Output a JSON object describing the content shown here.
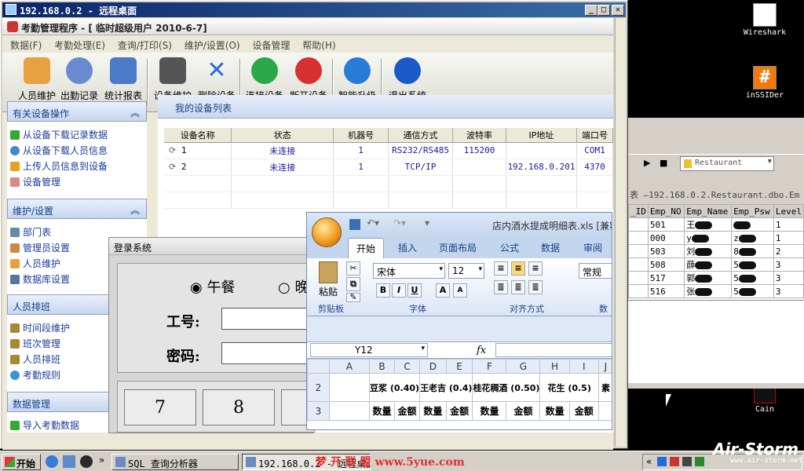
{
  "desktop": {
    "icons": [
      {
        "label": "Wireshark",
        "icon": "wireshark-icon"
      },
      {
        "label": "inSSIDer",
        "icon": "inssider-icon"
      },
      {
        "label": "Cain",
        "icon": "cain-icon"
      }
    ]
  },
  "sql_window": {
    "database_combo": "Restaurant",
    "tab_title": "表 —192.168.0.2.Restaurant.dbo.Em",
    "columns": [
      "_ID",
      "Emp_NO",
      "Emp_Name",
      "Emp_Psw",
      "Level"
    ],
    "rows": [
      {
        "emp_no": "501",
        "name": "王",
        "level": "1"
      },
      {
        "emp_no": "000",
        "name": "y",
        "psw": "z",
        "level": "1"
      },
      {
        "emp_no": "503",
        "name": "刘",
        "psw": "8",
        "level": "2"
      },
      {
        "emp_no": "508",
        "name": "薛",
        "psw": "5",
        "level": "3"
      },
      {
        "emp_no": "517",
        "name": "郭",
        "psw": "5",
        "level": "3"
      },
      {
        "emp_no": "516",
        "name": "张",
        "psw": "5",
        "level": "3"
      }
    ]
  },
  "rdp": {
    "title": "192.168.0.2 - 远程桌面",
    "min": "_",
    "max": "□",
    "close": "✕"
  },
  "app": {
    "title": "考勤管理程序 - [ 临时超级用户 2010-6-7]",
    "menu": [
      "数据(F)",
      "考勤处理(E)",
      "查询/打印(S)",
      "维护/设置(O)",
      "设备管理",
      "帮助(H)"
    ],
    "toolbar": [
      {
        "label": "人员维护",
        "icon": "people-icon",
        "color": "#e8a040"
      },
      {
        "label": "出勤记录",
        "icon": "clock-icon",
        "color": "#6a8ad0"
      },
      {
        "label": "统计报表",
        "icon": "report-icon",
        "color": "#4a7ac8"
      },
      {
        "label": "设备维护",
        "icon": "device-icon",
        "color": "#555555"
      },
      {
        "label": "删除设备",
        "icon": "delete-icon",
        "color": "#2a6ad8"
      },
      {
        "label": "连接设备",
        "icon": "connect-icon",
        "color": "#2aa84a"
      },
      {
        "label": "断开设备",
        "icon": "disconnect-icon",
        "color": "#d83030"
      },
      {
        "label": "智能升级",
        "icon": "globe-icon",
        "color": "#2a7ad8"
      },
      {
        "label": "退出系统",
        "icon": "power-icon",
        "color": "#1a5ac8"
      }
    ],
    "sidebar": {
      "device_ops": {
        "header": "有关设备操作",
        "items": [
          "从设备下载记录数据",
          "从设备下载人员信息",
          "上传人员信息到设备",
          "设备管理"
        ]
      },
      "maintenance": {
        "header": "维护/设置",
        "items": [
          "部门表",
          "管理员设置",
          "人员维护",
          "数据库设置"
        ]
      },
      "scheduling": {
        "header": "人员排班",
        "items": [
          "时间段维护",
          "班次管理",
          "人员排班",
          "考勤规则"
        ]
      },
      "data_mgmt": {
        "header": "数据管理",
        "items": [
          "导入考勤数据"
        ]
      }
    },
    "device_list": {
      "title": "我的设备列表",
      "columns": [
        "设备名称",
        "状态",
        "机器号",
        "通信方式",
        "波特率",
        "IP地址",
        "端口号"
      ],
      "rows": [
        {
          "name": "1",
          "status": "未连接",
          "machine": "1",
          "comm": "RS232/RS485",
          "baud": "115200",
          "ip": "",
          "port": "COM1"
        },
        {
          "name": "2",
          "status": "未连接",
          "machine": "1",
          "comm": "TCP/IP",
          "baud": "",
          "ip": "192.168.0.201",
          "port": "4370"
        }
      ]
    }
  },
  "login": {
    "title": "登录系统",
    "radio_lunch": "午餐",
    "radio_dinner": "晚",
    "id_label": "工号:",
    "pwd_label": "密码:",
    "keys": [
      "7",
      "8"
    ]
  },
  "excel": {
    "title": "店内酒水提成明细表.xls [兼容",
    "tabs": [
      "开始",
      "插入",
      "页面布局",
      "公式",
      "数据",
      "审阅"
    ],
    "clipboard_label": "剪贴板",
    "paste_label": "粘贴",
    "font_label": "字体",
    "align_label": "对齐方式",
    "number_label": "数字",
    "font_name": "宋体",
    "font_size": "12",
    "number_format": "常规",
    "name_box": "Y12",
    "fx": "fx",
    "col_headers": [
      "A",
      "B",
      "C",
      "D",
      "E",
      "F",
      "G",
      "H",
      "I",
      "J"
    ],
    "row_numbers": [
      "2",
      "3"
    ],
    "products": [
      "豆浆 (0.40)",
      "王老吉 (0.4)",
      "桂花稠酒 (0.50)",
      "花生 (0.5)",
      "素"
    ],
    "sub_headers": [
      "数量",
      "金额",
      "数量",
      "金额",
      "数量",
      "金额",
      "数量",
      "金额"
    ]
  },
  "taskbar": {
    "start": "开始",
    "tasks": [
      "SQL 查询分析器",
      "192.168.0.2 - 远程桌面"
    ],
    "watermark": "梦 开 联 盟  www.5yue.com"
  },
  "branding": {
    "name": "Air-Storm",
    "url": "www.air-storm.net"
  }
}
